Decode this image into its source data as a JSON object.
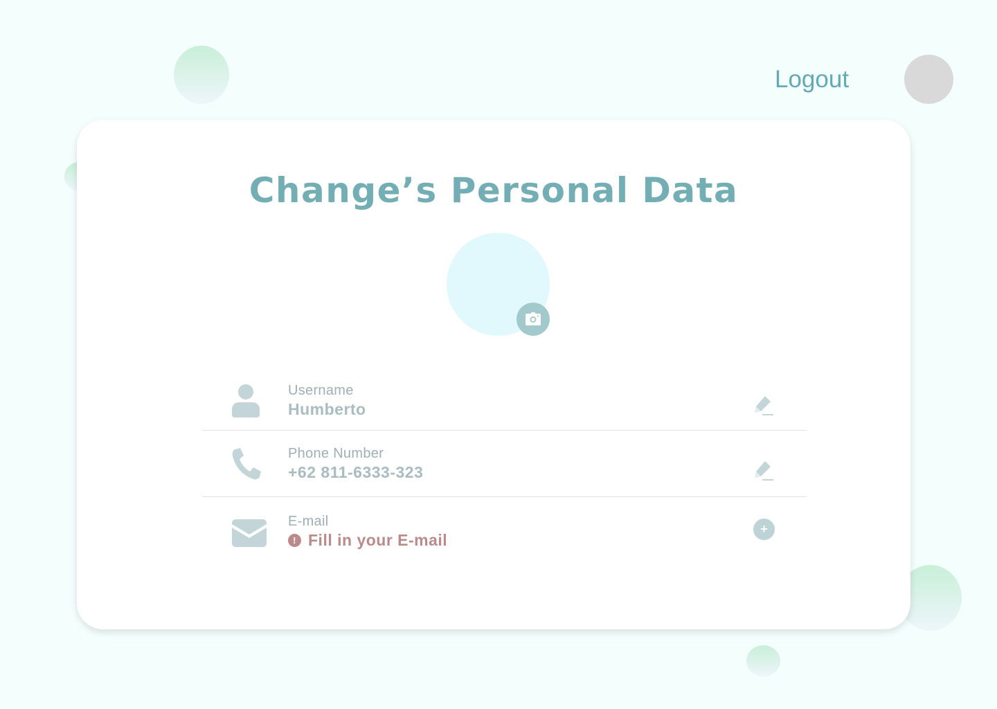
{
  "header": {
    "logout_label": "Logout"
  },
  "card": {
    "title": "Change’s Personal Data"
  },
  "fields": {
    "username": {
      "label": "Username",
      "value": "Humberto",
      "icon": "user-icon"
    },
    "phone": {
      "label": "Phone Number",
      "value": "+62 811-6333-323",
      "icon": "phone-icon"
    },
    "email": {
      "label": "E-mail",
      "value": "Fill in your E-mail",
      "status": "missing",
      "icon": "envelope-icon"
    }
  },
  "colors": {
    "accent": "#62aab5",
    "title": "#74aeb5",
    "warning": "#bb8a8a",
    "icon": "#c3d5d8",
    "background": "#f4fefd"
  }
}
